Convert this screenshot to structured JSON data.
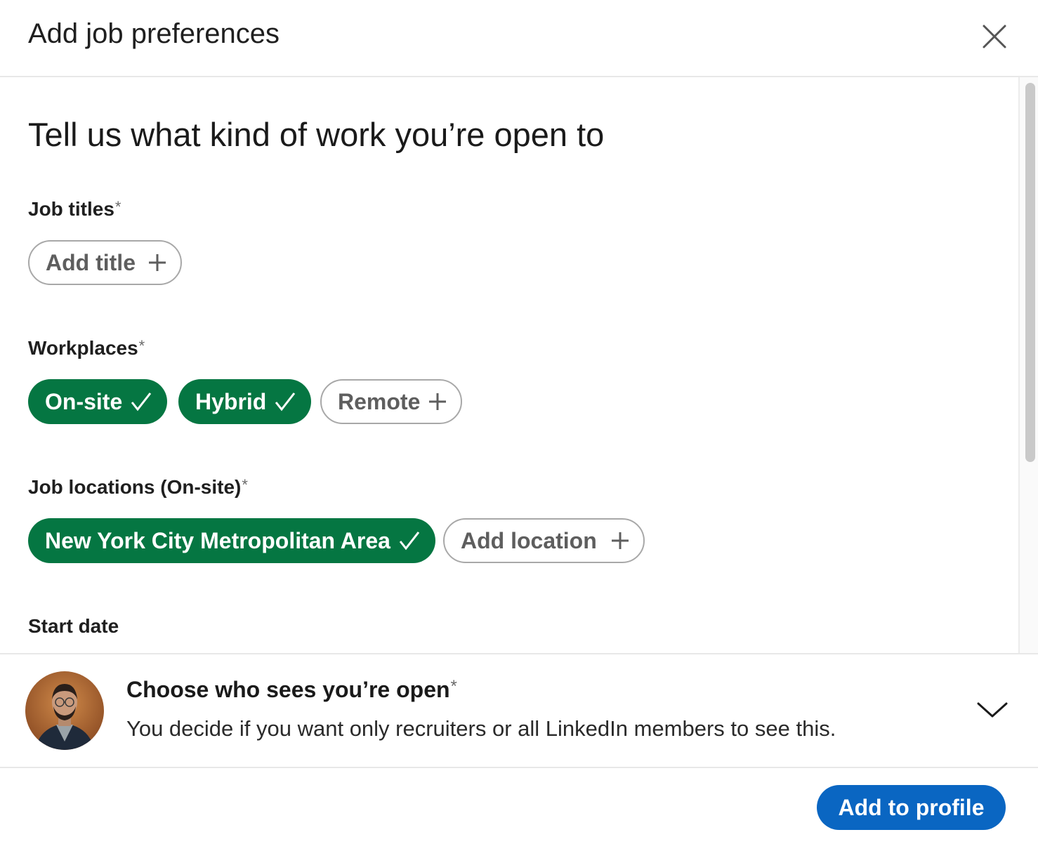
{
  "header": {
    "title": "Add job preferences",
    "close_icon": "close-icon"
  },
  "main": {
    "heading": "Tell us what kind of work you’re open to",
    "job_titles": {
      "label": "Job titles",
      "required_marker": "*",
      "add_button": {
        "label": "Add title",
        "icon": "plus-icon"
      }
    },
    "workplaces": {
      "label": "Workplaces",
      "required_marker": "*",
      "options": [
        {
          "label": "On-site",
          "selected": true,
          "icon": "check-icon"
        },
        {
          "label": "Hybrid",
          "selected": true,
          "icon": "check-icon"
        },
        {
          "label": "Remote",
          "selected": false,
          "icon": "plus-icon"
        }
      ]
    },
    "job_locations": {
      "label": "Job locations (On-site)",
      "required_marker": "*",
      "selected": [
        {
          "label": "New York City Metropolitan Area",
          "icon": "check-icon"
        }
      ],
      "add_button": {
        "label": "Add location",
        "icon": "plus-icon"
      }
    },
    "start_date": {
      "label": "Start date"
    }
  },
  "visibility": {
    "title": "Choose who sees you’re open",
    "required_marker": "*",
    "description": "You decide if you want only recruiters or all LinkedIn members to see this.",
    "expand_icon": "chevron-down-icon",
    "avatar": "profile-avatar"
  },
  "footer": {
    "primary_button": "Add to profile"
  },
  "colors": {
    "selected_pill": "#057642",
    "primary_button": "#0a66c2",
    "outline_border": "#a8a8a8"
  }
}
